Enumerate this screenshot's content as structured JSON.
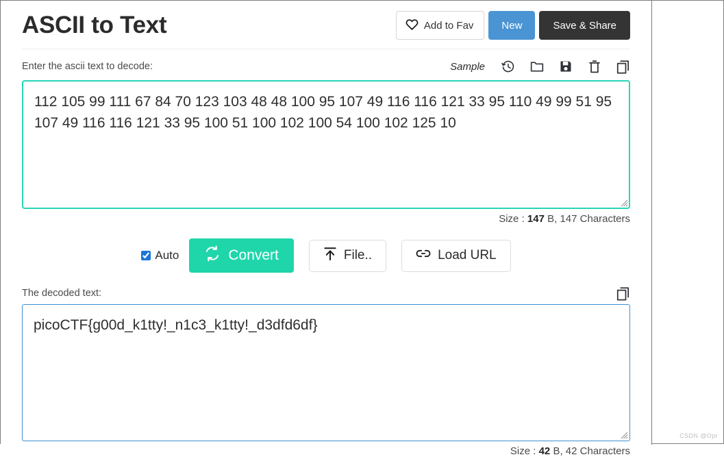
{
  "header": {
    "title": "ASCII to Text",
    "add_to_fav_label": "Add to Fav",
    "new_label": "New",
    "save_share_label": "Save & Share",
    "heart_icon": "heart-icon"
  },
  "input_section": {
    "label": "Enter the ascii text to decode:",
    "sample_label": "Sample",
    "icons": [
      {
        "name": "history-icon"
      },
      {
        "name": "folder-icon"
      },
      {
        "name": "save-icon"
      },
      {
        "name": "trash-icon"
      },
      {
        "name": "copy-icon"
      }
    ],
    "value": "112 105 99 111 67 84 70 123 103 48 48 100 95 107 49 116 116 121 33 95 110 49 99 51 95 107 49 116 116 121 33 95 100 51 100 102 100 54 100 102 125 10",
    "placeholder": "",
    "size_prefix": "Size : ",
    "size_bytes": "147",
    "size_suffix": " B, 147 Characters"
  },
  "actions": {
    "auto_label": "Auto",
    "auto_checked": true,
    "convert_label": "Convert",
    "convert_icon": "sync-icon",
    "file_label": "File..",
    "file_icon": "upload-icon",
    "load_url_label": "Load URL",
    "load_url_icon": "link-icon"
  },
  "output_section": {
    "label": "The decoded text:",
    "copy_icon": "copy-icon",
    "value": "picoCTF{g00d_k1tty!_n1c3_k1tty!_d3dfd6df}",
    "size_prefix": "Size : ",
    "size_bytes": "42",
    "size_suffix": " B, 42 Characters"
  },
  "watermark": {
    "text": "CSDN @Opr"
  },
  "colors": {
    "accent_teal": "#1fd6ab",
    "input_border": "#27d6b7",
    "output_border": "#3f8fd0",
    "new_button": "#4a94d4",
    "save_share_button": "#343434",
    "checkbox": "#1c76d8"
  }
}
